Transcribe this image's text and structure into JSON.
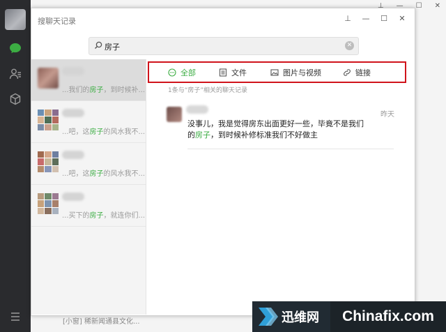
{
  "dialog": {
    "title": "搜聊天记录",
    "controls": {
      "pin": "⊥",
      "minimize": "—",
      "maximize": "☐",
      "close": "✕"
    }
  },
  "background_window": {
    "controls": {
      "pin": "⊥",
      "minimize": "—",
      "maximize": "☐",
      "close": "✕"
    },
    "bottom_snippet": "[小窗] 稀新闻通县文化..."
  },
  "sidebar": {
    "icons": [
      "avatar",
      "chat-icon",
      "contacts-icon",
      "favorites-icon",
      "menu-icon"
    ]
  },
  "search": {
    "value": "房子"
  },
  "results": [
    {
      "prefix": "...我们的",
      "keyword": "房子",
      "suffix": "，到时候补...",
      "active": true
    },
    {
      "prefix": "...吧，这",
      "keyword": "房子",
      "suffix": "的风水我不...",
      "active": false
    },
    {
      "prefix": "...吧，这",
      "keyword": "房子",
      "suffix": "的风水我不...",
      "active": false
    },
    {
      "prefix": "...买下的",
      "keyword": "房子",
      "suffix": "，就连你们...",
      "active": false
    }
  ],
  "filters": {
    "all": "全部",
    "file": "文件",
    "image_video": "图片与视频",
    "link": "链接",
    "selected": "all"
  },
  "result_count": "1条与“房子”相关的聊天记录",
  "message": {
    "time": "昨天",
    "line1": "没事儿，我是觉得房东出面更好一些，毕竟不是我们",
    "line2_prefix": "的",
    "line2_keyword": "房子",
    "line2_suffix": "，到时候补修标准我们不好做主"
  },
  "watermark": {
    "cn": "迅维网",
    "en": "Chinafix.com"
  },
  "colors": {
    "accent_green": "#3cad43",
    "highlight_red": "#d0131b",
    "rail_dark": "#2a2b2e"
  }
}
